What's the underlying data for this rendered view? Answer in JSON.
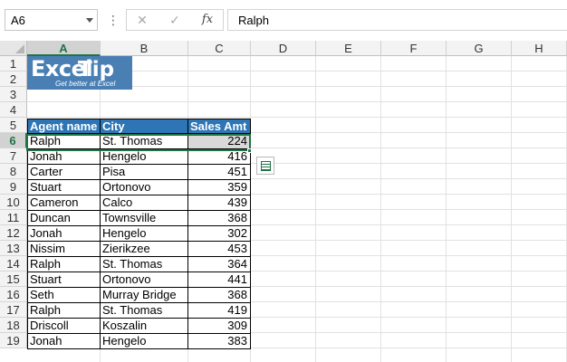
{
  "formula_bar": {
    "name_box": "A6",
    "separator": "⋮",
    "cancel_symbol": "✕",
    "enter_symbol": "✓",
    "fx_symbol": "fx",
    "formula_value": "Ralph"
  },
  "columns": [
    "A",
    "B",
    "C",
    "D",
    "E",
    "F",
    "G",
    "H"
  ],
  "rows": [
    "1",
    "2",
    "3",
    "4",
    "5",
    "6",
    "7",
    "8",
    "9",
    "10",
    "11",
    "12",
    "13",
    "14",
    "15",
    "16",
    "17",
    "18",
    "19"
  ],
  "selected": {
    "column": "A",
    "row": "6"
  },
  "logo": {
    "line1_a": "Excel",
    "line1_b": "Tip",
    "tagline": "Get better at Excel"
  },
  "table": {
    "headers": [
      "Agent name",
      "City",
      "Sales Amt"
    ],
    "rows": [
      [
        "Ralph",
        "St. Thomas",
        "224"
      ],
      [
        "Jonah",
        "Hengelo",
        "416"
      ],
      [
        "Carter",
        "Pisa",
        "451"
      ],
      [
        "Stuart",
        "Ortonovo",
        "359"
      ],
      [
        "Cameron",
        "Calco",
        "439"
      ],
      [
        "Duncan",
        "Townsville",
        "368"
      ],
      [
        "Jonah",
        "Hengelo",
        "302"
      ],
      [
        "Nissim",
        "Zierikzee",
        "453"
      ],
      [
        "Ralph",
        "St. Thomas",
        "364"
      ],
      [
        "Stuart",
        "Ortonovo",
        "441"
      ],
      [
        "Seth",
        "Murray Bridge",
        "368"
      ],
      [
        "Ralph",
        "St. Thomas",
        "419"
      ],
      [
        "Driscoll",
        "Koszalin",
        "309"
      ],
      [
        "Jonah",
        "Hengelo",
        "383"
      ]
    ]
  },
  "colors": {
    "header_fill": "#2e75b6",
    "selection": "#217346",
    "logo_bg": "#4a7fb4"
  }
}
